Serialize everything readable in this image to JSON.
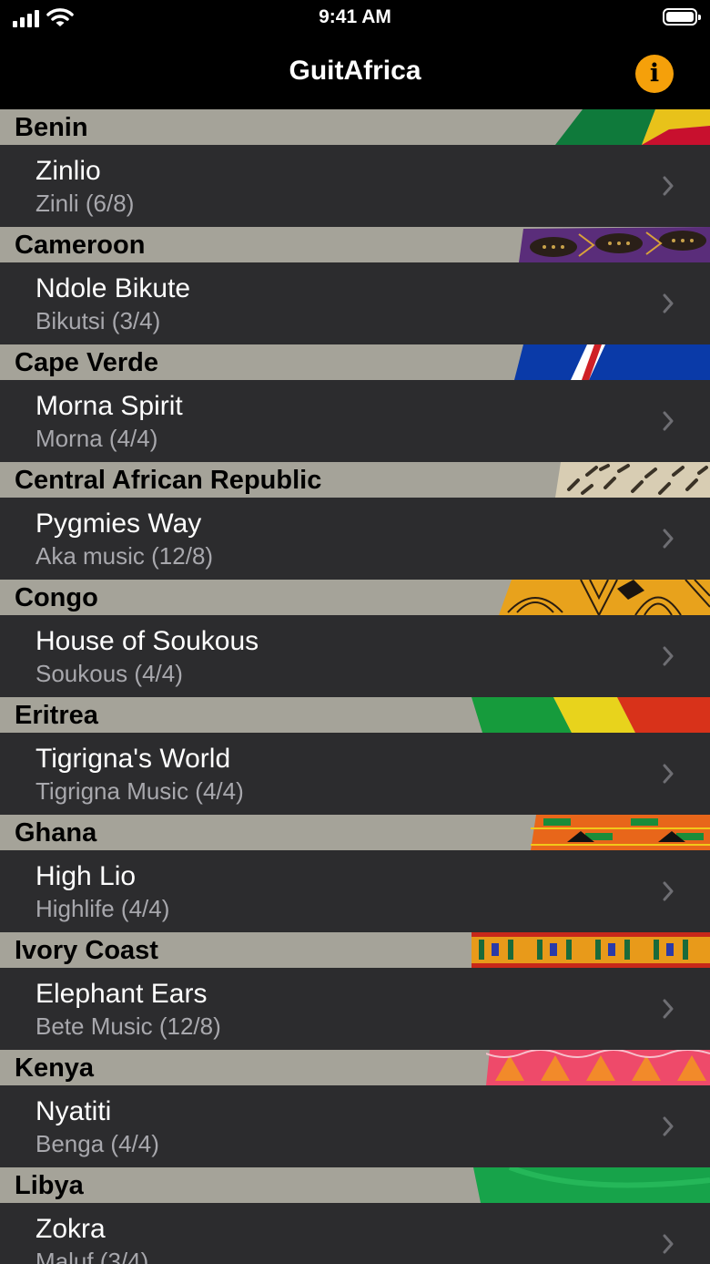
{
  "status": {
    "time": "9:41 AM"
  },
  "nav": {
    "title": "GuitAfrica",
    "info_icon": "info-icon"
  },
  "accent": "#f5a00a",
  "sections": [
    {
      "country": "Benin",
      "title": "Zinlio",
      "subtitle": "Zinli (6/8)"
    },
    {
      "country": "Cameroon",
      "title": "Ndole Bikute",
      "subtitle": "Bikutsi  (3/4)"
    },
    {
      "country": "Cape Verde",
      "title": "Morna Spirit",
      "subtitle": "Morna (4/4)"
    },
    {
      "country": "Central African Republic",
      "title": "Pygmies Way",
      "subtitle": "Aka music (12/8)"
    },
    {
      "country": "Congo",
      "title": "House of Soukous",
      "subtitle": "Soukous (4/4)"
    },
    {
      "country": "Eritrea",
      "title": "Tigrigna's World",
      "subtitle": "Tigrigna Music (4/4)"
    },
    {
      "country": "Ghana",
      "title": "High Lio",
      "subtitle": "Highlife (4/4)"
    },
    {
      "country": "Ivory Coast",
      "title": "Elephant Ears",
      "subtitle": "Bete Music (12/8)"
    },
    {
      "country": "Kenya",
      "title": "Nyatiti",
      "subtitle": "Benga (4/4)"
    },
    {
      "country": "Libya",
      "title": "Zokra",
      "subtitle": "Maluf (3/4)"
    }
  ]
}
